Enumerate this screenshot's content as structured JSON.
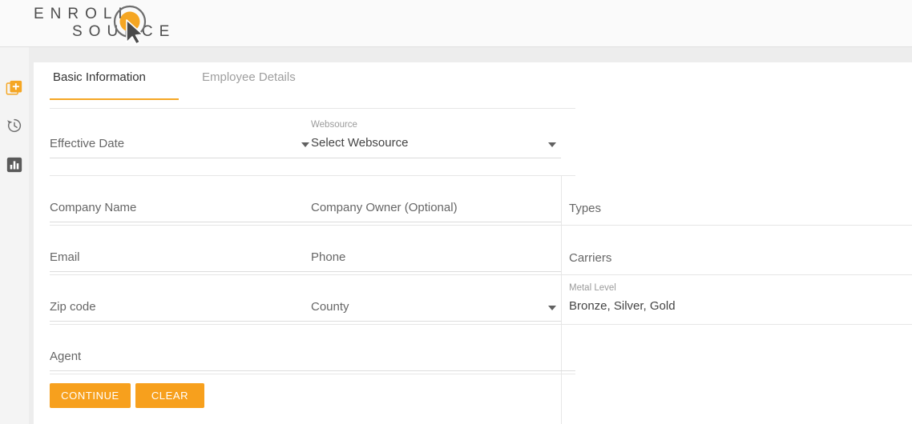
{
  "brand": {
    "line1": "ENROLL",
    "line2": "SOURCE",
    "mark_color": "#f5a623",
    "ring_color": "#6d6d6d",
    "cursor_color": "#4a4a4a"
  },
  "rail": {
    "items": [
      {
        "icon": "add-document-icon",
        "color": "#f5a623"
      },
      {
        "icon": "history-icon",
        "color": "#6e6e6e"
      },
      {
        "icon": "bar-chart-icon",
        "color": "#5a5a5a"
      }
    ]
  },
  "tabs": {
    "accent": "#f5a623",
    "items": [
      {
        "label": "Basic Information",
        "active": true
      },
      {
        "label": "Employee Details",
        "active": false
      }
    ]
  },
  "form": {
    "effective_date": {
      "label": "Effective Date",
      "value": "",
      "float": ""
    },
    "websource": {
      "label": "Select Websource",
      "float": "Websource"
    },
    "company_name": {
      "label": "Company Name"
    },
    "company_owner": {
      "label": "Company Owner (Optional)"
    },
    "types": {
      "label": "Types"
    },
    "email": {
      "label": "Email"
    },
    "phone": {
      "label": "Phone"
    },
    "carriers": {
      "label": "Carriers"
    },
    "zip_code": {
      "label": "Zip code"
    },
    "county": {
      "label": "County"
    },
    "metal_level": {
      "float": "Metal Level",
      "value": "Bronze, Silver, Gold"
    },
    "agent": {
      "label": "Agent"
    }
  },
  "actions": {
    "continue_label": "CONTINUE",
    "clear_label": "CLEAR",
    "color": "#f7a01d"
  }
}
